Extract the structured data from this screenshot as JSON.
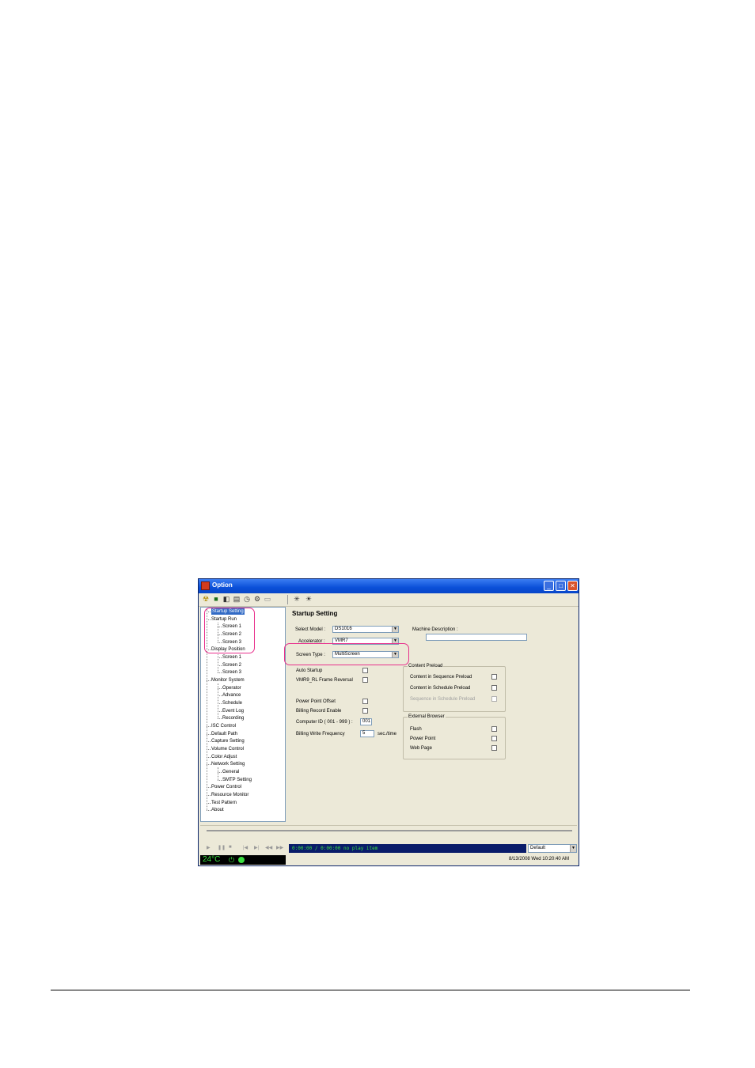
{
  "window": {
    "title": "Option",
    "min_glyph": "_",
    "max_glyph": "□",
    "close_glyph": "✕"
  },
  "toolbar": {
    "icons": [
      "radiation-icon",
      "record-icon",
      "screens-icon",
      "document-icon",
      "clock-icon",
      "tools-icon",
      "list-icon",
      "brightness-down-icon",
      "brightness-up-icon"
    ],
    "glyphs": [
      "☢",
      "■",
      "◧",
      "▤",
      "◷",
      "⚙",
      "▭",
      "✳",
      "☀"
    ]
  },
  "tree": {
    "items": [
      {
        "label": "Startup Setting",
        "level": 0,
        "selected": true
      },
      {
        "label": "Startup Run",
        "level": 0
      },
      {
        "label": "Screen 1",
        "level": 1
      },
      {
        "label": "Screen 2",
        "level": 1
      },
      {
        "label": "Screen 3",
        "level": 1
      },
      {
        "label": "Display Position",
        "level": 0
      },
      {
        "label": "Screen 1",
        "level": 1
      },
      {
        "label": "Screen 2",
        "level": 1
      },
      {
        "label": "Screen 3",
        "level": 1
      },
      {
        "label": "Monitor System",
        "level": 0
      },
      {
        "label": "Operator",
        "level": 1
      },
      {
        "label": "Advance",
        "level": 1
      },
      {
        "label": "Schedule",
        "level": 1
      },
      {
        "label": "Event Log",
        "level": 1
      },
      {
        "label": "Recording",
        "level": 1
      },
      {
        "label": "ISC Control",
        "level": 0
      },
      {
        "label": "Default Path",
        "level": 0
      },
      {
        "label": "Capture Setting",
        "level": 0
      },
      {
        "label": "Volume Control",
        "level": 0
      },
      {
        "label": "Color Adjust",
        "level": 0
      },
      {
        "label": "Network Setting",
        "level": 0
      },
      {
        "label": "General",
        "level": 1
      },
      {
        "label": "SMTP Setting",
        "level": 1
      },
      {
        "label": "Power Control",
        "level": 0
      },
      {
        "label": "Resource Monitor",
        "level": 0
      },
      {
        "label": "Test Pattern",
        "level": 0
      },
      {
        "label": "About",
        "level": 0
      }
    ]
  },
  "settings": {
    "title": "Startup Setting",
    "select_model_label": "Select Model :",
    "select_model_value": "DS1016",
    "accelerator_label": "Accelerator :",
    "accelerator_value": "VMR7",
    "screen_type_label": "Screen Type :",
    "screen_type_value": "MultiScreen",
    "machine_description_label": "Machine Description :",
    "machine_description_value": "",
    "auto_startup_label": "Auto Startup",
    "vmr9_label": "VMR9_RL Frame Reversal",
    "power_point_offset_label": "Power Point Offset",
    "billing_record_label": "Billing Record Enable",
    "computer_id_label": "Computer ID ( 001 - 999 ) :",
    "computer_id_value": "001",
    "billing_write_label": "Billing Write Frequency",
    "billing_write_value": "5",
    "billing_write_unit": "sec./time",
    "content_preload": {
      "title": "Content Preload",
      "seq_label": "Content in Sequence Preload",
      "sched_label": "Content in Schedule Preload",
      "seq_sched_label": "Sequence in Schedule Preload"
    },
    "external_browser": {
      "title": "External Browser",
      "flash_label": "Flash",
      "ppt_label": "Power Point",
      "web_label": "Web Page"
    }
  },
  "player": {
    "buttons": [
      "▶",
      "❚❚",
      "■",
      "|◀",
      "▶|",
      "◀◀",
      "▶▶"
    ],
    "time_text": "0:00:00 / 0:00:00  no play item",
    "profile_value": "Default"
  },
  "status": {
    "temperature": "24°C",
    "datetime": "8/13/2008 Wed 10:20:40 AM"
  },
  "colors": {
    "highlight": "#e8308c",
    "time_green": "#3be040"
  }
}
